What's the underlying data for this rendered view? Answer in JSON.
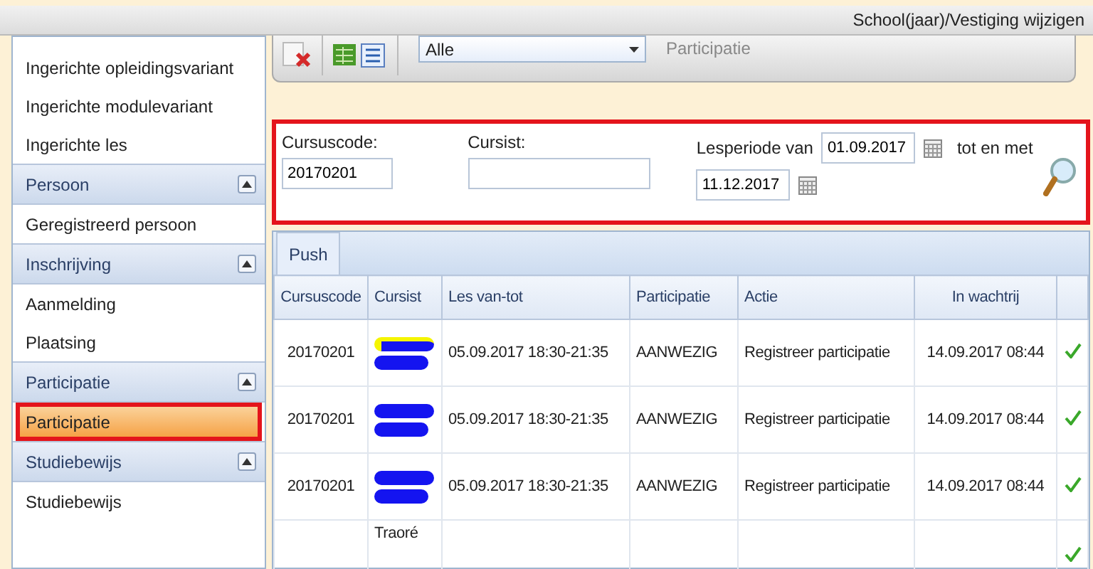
{
  "top_bar": {
    "link": "School(jaar)/Vestiging wijzigen"
  },
  "sidebar": {
    "items": [
      {
        "kind": "item",
        "label": "Ingerichte opleidingsvariant",
        "selected": false
      },
      {
        "kind": "item",
        "label": "Ingerichte modulevariant",
        "selected": false
      },
      {
        "kind": "item",
        "label": "Ingerichte les",
        "selected": false
      },
      {
        "kind": "group",
        "label": "Persoon",
        "expanded": true
      },
      {
        "kind": "item",
        "label": "Geregistreerd persoon",
        "selected": false
      },
      {
        "kind": "group",
        "label": "Inschrijving",
        "expanded": true
      },
      {
        "kind": "item",
        "label": "Aanmelding",
        "selected": false
      },
      {
        "kind": "item",
        "label": "Plaatsing",
        "selected": false
      },
      {
        "kind": "group",
        "label": "Participatie",
        "expanded": true
      },
      {
        "kind": "item",
        "label": "Participatie",
        "selected": true
      },
      {
        "kind": "group",
        "label": "Studiebewijs",
        "expanded": true
      },
      {
        "kind": "item",
        "label": "Studiebewijs",
        "selected": false
      }
    ]
  },
  "toolbar": {
    "filter_value": "Alle",
    "title": "Participatie"
  },
  "filters": {
    "course_code": {
      "label": "Cursuscode:",
      "value": "20170201"
    },
    "student": {
      "label": "Cursist:"
    },
    "period": {
      "label": "Lesperiode van",
      "from": "01.09.2017",
      "to_label": "tot en met",
      "to": "11.12.2017"
    }
  },
  "grid": {
    "tab": "Push",
    "columns": [
      "Cursuscode",
      "Cursist",
      "Les van-tot",
      "Participatie",
      "Actie",
      "In wachtrij"
    ],
    "rows": [
      {
        "code": "20170201",
        "student": "",
        "redacted": true,
        "highlight": true,
        "period": "05.09.2017 18:30-21:35",
        "participation": "AANWEZIG",
        "action": "Registreer participatie",
        "queued": "14.09.2017 08:44",
        "checked": true
      },
      {
        "code": "20170201",
        "student": "",
        "redacted": true,
        "highlight": false,
        "period": "05.09.2017 18:30-21:35",
        "participation": "AANWEZIG",
        "action": "Registreer participatie",
        "queued": "14.09.2017 08:44",
        "checked": true
      },
      {
        "code": "20170201",
        "student": "",
        "redacted": true,
        "highlight": false,
        "period": "05.09.2017 18:30-21:35",
        "participation": "AANWEZIG",
        "action": "Registreer participatie",
        "queued": "14.09.2017 08:44",
        "checked": true
      },
      {
        "code": "",
        "student": "Traoré",
        "period": "",
        "participation": "",
        "action": "",
        "queued": "",
        "checked": true
      }
    ]
  }
}
